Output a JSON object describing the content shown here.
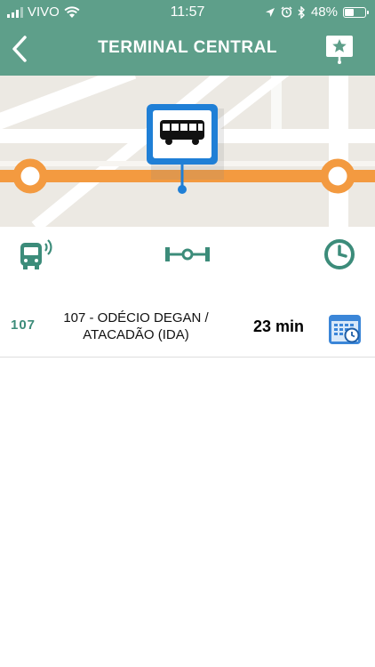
{
  "status_bar": {
    "carrier": "VIVO",
    "time": "11:57",
    "battery_percent": "48%",
    "battery_level": 0.48
  },
  "header": {
    "title": "TERMINAL CENTRAL",
    "back_icon": "chevron-left-icon",
    "favorite_icon": "star-pin-icon"
  },
  "map": {
    "route_color": "#f39a40",
    "stop_icon": "bus-stop-icon",
    "stop_color": "#1f7fd6"
  },
  "route_bar": {
    "icons": [
      "bus-realtime-icon",
      "route-segment-icon",
      "clock-icon"
    ]
  },
  "lines": [
    {
      "code": "107",
      "name_line1": "107 - ODÉCIO DEGAN /",
      "name_line2": "ATACADÃO (IDA)",
      "eta": "23 min",
      "schedule_icon": "calendar-clock-icon"
    }
  ]
}
